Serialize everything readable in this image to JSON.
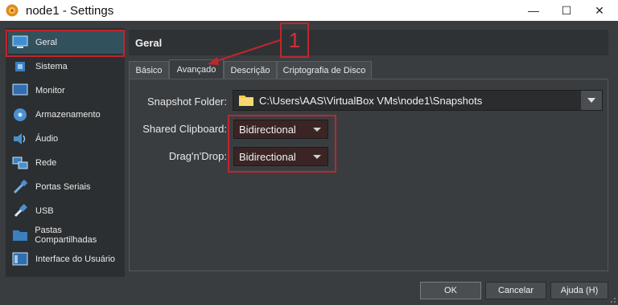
{
  "window": {
    "title": "node1 - Settings",
    "minimize_glyph": "—",
    "maximize_glyph": "☐",
    "close_glyph": "✕"
  },
  "sidebar": {
    "items": [
      {
        "label": "Geral",
        "icon": "monitor-icon"
      },
      {
        "label": "Sistema",
        "icon": "chip-icon"
      },
      {
        "label": "Monitor",
        "icon": "display-icon"
      },
      {
        "label": "Armazenamento",
        "icon": "disk-icon"
      },
      {
        "label": "Áudio",
        "icon": "speaker-icon"
      },
      {
        "label": "Rede",
        "icon": "network-icon"
      },
      {
        "label": "Portas Seriais",
        "icon": "serial-port-icon"
      },
      {
        "label": "USB",
        "icon": "usb-icon"
      },
      {
        "label": "Pastas Compartilhadas",
        "icon": "folder-icon"
      },
      {
        "label": "Interface do Usuário",
        "icon": "ui-window-icon"
      }
    ]
  },
  "panel": {
    "title": "Geral",
    "tabs": [
      "Básico",
      "Avançado",
      "Descrição",
      "Criptografia de Disco"
    ],
    "active_tab": "Avançado"
  },
  "advanced": {
    "snapshot_label": "Snapshot Folder:",
    "snapshot_path": "C:\\Users\\AAS\\VirtualBox VMs\\node1\\Snapshots",
    "clipboard_label": "Shared Clipboard:",
    "clipboard_value": "Bidirectional",
    "dragdrop_label": "Drag'n'Drop:",
    "dragdrop_value": "Bidirectional"
  },
  "annotation": {
    "number": "1"
  },
  "buttons": {
    "ok": "OK",
    "cancel": "Cancelar",
    "help": "Ajuda (H)"
  },
  "colors": {
    "background": "#3a3d40",
    "selected": "#33515c",
    "annotation_red": "#c0262d",
    "folder_yellow": "#f2c94c"
  }
}
